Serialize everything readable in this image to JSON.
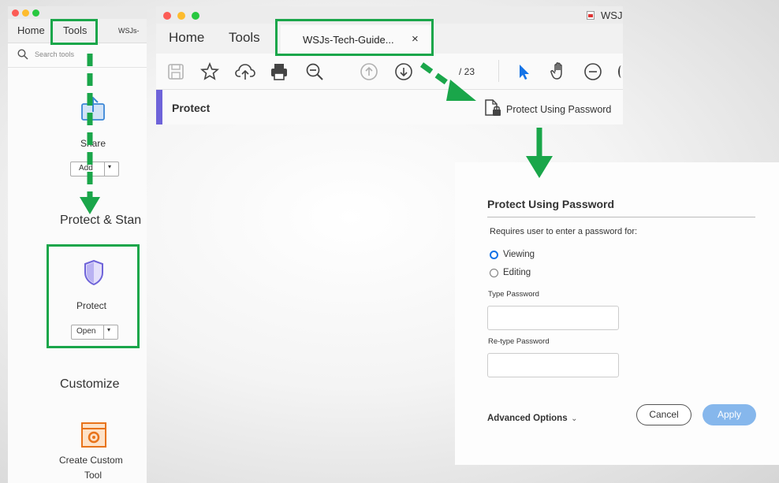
{
  "left_panel": {
    "tabs": {
      "home": "Home",
      "tools": "Tools",
      "doc": "WSJs-"
    },
    "search_placeholder": "Search tools",
    "share": {
      "label": "Share",
      "button": "Add"
    },
    "section_protect": "Protect & Stan",
    "protect": {
      "label": "Protect",
      "button": "Open"
    },
    "section_customize": "Customize",
    "custom_tool": {
      "label_line1": "Create Custom",
      "label_line2": "Tool"
    }
  },
  "main_window": {
    "title_right": "WSJ",
    "tabs": {
      "home": "Home",
      "tools": "Tools",
      "doc": "WSJs-Tech-Guide...",
      "close": "×"
    },
    "page_indicator": "/ 23",
    "protect_bar_label": "Protect",
    "protect_using_password": "Protect Using Password"
  },
  "dialog": {
    "title": "Protect Using Password",
    "prompt": "Requires user to enter a password for:",
    "option_viewing": "Viewing",
    "option_editing": "Editing",
    "type_password_label": "Type Password",
    "retype_password_label": "Re-type Password",
    "advanced_options": "Advanced Options",
    "cancel": "Cancel",
    "apply": "Apply"
  },
  "colors": {
    "highlight_green": "#1aa64a",
    "accent_blue": "#1473e6",
    "protect_bar": "#6e63d9"
  }
}
